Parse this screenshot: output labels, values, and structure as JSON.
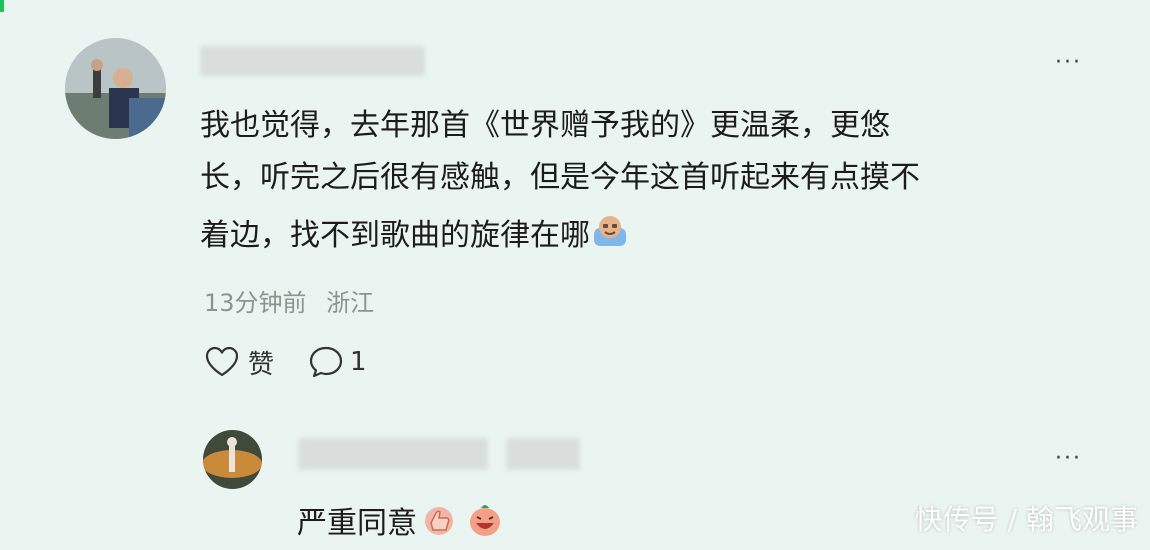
{
  "comment": {
    "text_lines": [
      "我也觉得，去年那首《世界赠予我的》更温柔，更悠",
      "长，听完之后很有感触，但是今年这首听起来有点摸不",
      "着边，找不到歌曲的旋律在哪"
    ],
    "time": "13分钟前",
    "location": "浙江",
    "like_label": "赞",
    "reply_count": "1",
    "trailing_emoji": "crying-emoji"
  },
  "reply": {
    "text": "严重同意",
    "emojis": [
      "thumbs-up-emoji",
      "laughing-emoji"
    ]
  },
  "more_label": "···",
  "watermark": "快传号 / 翰飞观事",
  "colors": {
    "background": "#eaf5f1",
    "accent": "#21c25e",
    "meta": "#8d9490"
  }
}
